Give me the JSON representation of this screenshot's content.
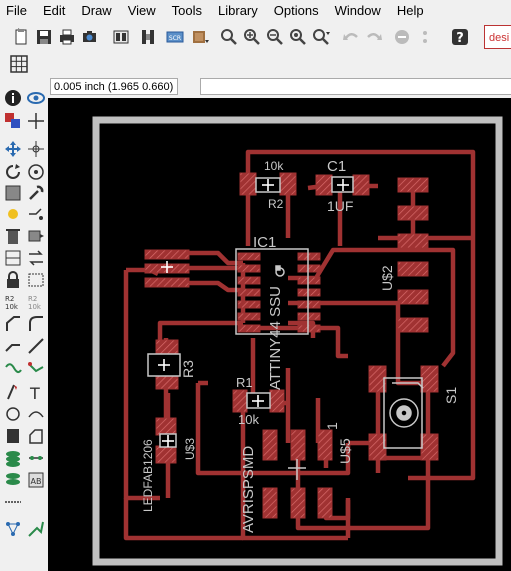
{
  "menu": [
    "File",
    "Edit",
    "Draw",
    "View",
    "Tools",
    "Library",
    "Options",
    "Window",
    "Help"
  ],
  "tab_partial": "desi",
  "coordinate_readout": "0.005 inch (1.965 0.660)",
  "command_value": "",
  "board_labels": {
    "r2_value": "10k",
    "r2_name": "R2",
    "c1_name": "C1",
    "c1_value": "1UF",
    "ic1_name": "IC1",
    "ic1_value": "ATTINY44 SSU",
    "us2": "U$2",
    "r3": "R3",
    "r1_name": "R1",
    "r1_value": "10k",
    "s1": "S1",
    "ledfab": "LEDFAB1206",
    "us3": "U$3",
    "avrisp": "AVRISPSMD",
    "us5": "U$5",
    "one": "1"
  },
  "colors": {
    "trace": "#a03232",
    "pad": "#a03232",
    "silk": "#c8c8c8",
    "background": "#000000",
    "board_outline": "#c0c0c0"
  }
}
